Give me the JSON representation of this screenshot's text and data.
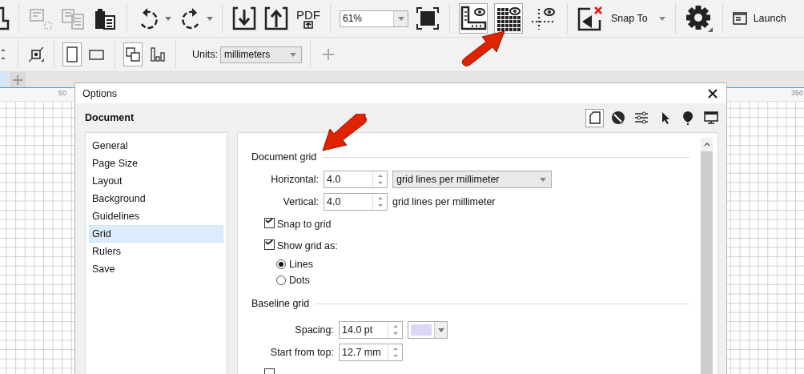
{
  "toolbar": {
    "edit_buttons": [
      {
        "disabled": true
      },
      {
        "disabled": true
      },
      {
        "disabled": false
      }
    ],
    "pdf_label": "PDF",
    "zoom": "61%",
    "view_toggles": [
      {
        "pressed": true
      },
      {
        "pressed": true
      },
      {
        "pressed": false
      }
    ],
    "snap_to": "Snap To",
    "launch": "Launch"
  },
  "property_bar": {
    "orientation": [
      {
        "selected": true
      },
      {
        "selected": false
      }
    ],
    "page_layout": [
      {
        "selected": true
      },
      {
        "selected": false
      }
    ],
    "units_label": "Units:",
    "units": "millimeters"
  },
  "ruler": {
    "ticks": [
      "50",
      "350"
    ]
  },
  "dialog": {
    "title": "Options",
    "heading": "Document",
    "category_tabs": [
      {
        "selected": true
      },
      {
        "selected": false
      },
      {
        "selected": false
      },
      {
        "selected": false
      },
      {
        "selected": false
      },
      {
        "selected": false
      }
    ],
    "pages": [
      {
        "label": "General",
        "selected": false
      },
      {
        "label": "Page Size",
        "selected": false
      },
      {
        "label": "Layout",
        "selected": false
      },
      {
        "label": "Background",
        "selected": false
      },
      {
        "label": "Guidelines",
        "selected": false
      },
      {
        "label": "Grid",
        "selected": true
      },
      {
        "label": "Rulers",
        "selected": false
      },
      {
        "label": "Save",
        "selected": false
      }
    ],
    "sections": [
      {
        "title": "Document grid",
        "rows": [
          {
            "kind": "spin",
            "label": "Horizontal:",
            "value": "4.0",
            "unit_dropdown": "grid lines per millimeter"
          },
          {
            "kind": "spin",
            "label": "Vertical:",
            "value": "4.0",
            "unit_text": "grid lines per millimeter"
          },
          {
            "kind": "checkbox",
            "label": "Snap to grid",
            "checked": true
          },
          {
            "kind": "checkbox",
            "label": "Show grid as:",
            "checked": true
          },
          {
            "kind": "radio",
            "label": "Lines",
            "selected": true
          },
          {
            "kind": "radio",
            "label": "Dots",
            "selected": false
          }
        ]
      },
      {
        "title": "Baseline grid",
        "rows": [
          {
            "kind": "spin",
            "label": "Spacing:",
            "value": "14.0 pt",
            "color": "#dcd6f7"
          },
          {
            "kind": "spin",
            "label": "Start from top:",
            "value": "12.7 mm"
          },
          {
            "kind": "checkbox",
            "checked": false
          }
        ]
      }
    ]
  }
}
